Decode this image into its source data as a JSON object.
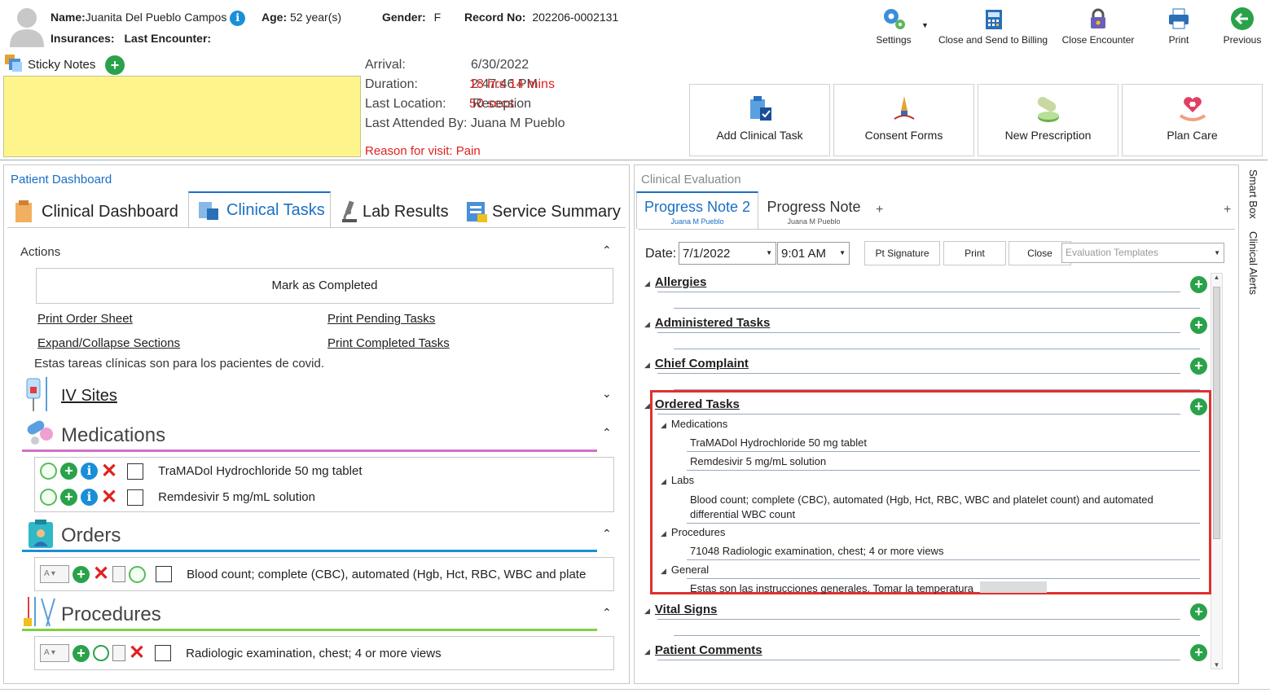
{
  "patient": {
    "name_label": "Name:",
    "name": "Juanita Del Pueblo Campos",
    "age_label": "Age:",
    "age": "52 year(s)",
    "gender_label": "Gender:",
    "gender": "F",
    "record_label": "Record No:",
    "record": "202206-0002131",
    "insurances_label": "Insurances:",
    "last_encounter_label": "Last Encounter:"
  },
  "sticky": {
    "label": "Sticky Notes"
  },
  "visit": {
    "arrival_label": "Arrival:",
    "arrival": "6/30/2022 2:47:46 PM",
    "duration_label": "Duration:",
    "duration": "18 hrs 14 mins 50 secs",
    "location_label": "Last Location:",
    "location": "Reception",
    "attended_label": "Last Attended By:",
    "attended": "Juana M Pueblo",
    "reason": "Reason for visit: Pain"
  },
  "toolbar": {
    "settings": "Settings",
    "billing": "Close and Send to Billing",
    "close_encounter": "Close Encounter",
    "print": "Print",
    "previous": "Previous"
  },
  "big_buttons": {
    "add_task": "Add Clinical Task",
    "consent": "Consent Forms",
    "prescription": "New Prescription",
    "plan_care": "Plan Care"
  },
  "dashboard": {
    "title": "Patient Dashboard",
    "tabs": [
      "Clinical Dashboard",
      "Clinical Tasks",
      "Lab Results",
      "Service Summary"
    ],
    "actions_label": "Actions",
    "mark_completed": "Mark as Completed",
    "print_order": "Print Order Sheet",
    "print_pending": "Print Pending Tasks",
    "expand_collapse": "Expand/Collapse Sections",
    "print_completed": "Print Completed Tasks",
    "note": "Estas tareas clínicas son para los pacientes de covid.",
    "iv_sites": "IV Sites",
    "medications_label": "Medications",
    "medications": [
      "TraMADol Hydrochloride 50 mg tablet",
      "Remdesivir 5 mg/mL solution"
    ],
    "orders_label": "Orders",
    "order_item": "Blood count; complete (CBC), automated (Hgb, Hct, RBC, WBC and plate",
    "procedures_label": "Procedures",
    "procedure_item": "Radiologic examination, chest; 4 or more views",
    "dd_text": "A"
  },
  "evaluation": {
    "title": "Clinical Evaluation",
    "tab1": "Progress Note 2",
    "tab1_sub": "Juana M Pueblo",
    "tab2": "Progress Note",
    "tab2_sub": "Juana M Pueblo",
    "plus": "+",
    "date_label": "Date:",
    "date": "7/1/2022",
    "time": "9:01 AM",
    "pt_signature": "Pt Signature",
    "print": "Print",
    "close": "Close",
    "templates_placeholder": "Evaluation Templates",
    "sections": {
      "allergies": "Allergies",
      "administered": "Administered Tasks",
      "chief": "Chief Complaint",
      "ordered": "Ordered Tasks",
      "vital": "Vital Signs",
      "comments": "Patient Comments"
    },
    "ordered": {
      "medications_label": "Medications",
      "medications": [
        "TraMADol Hydrochloride 50 mg tablet",
        "Remdesivir 5 mg/mL solution"
      ],
      "labs_label": "Labs",
      "lab_line1": "Blood count; complete (CBC), automated (Hgb, Hct, RBC, WBC and platelet count) and automated",
      "lab_line2": "differential WBC count",
      "procedures_label": "Procedures",
      "procedure": "71048 Radiologic examination, chest; 4 or more views",
      "general_label": "General",
      "general": "Estas son las instrucciones generales. Tomar la temperatura"
    }
  },
  "side": {
    "smart_box": "Smart Box",
    "clinical_alerts": "Clinical Alerts"
  },
  "colors": {
    "accent": "#1a6fc4",
    "highlight": "#e03030",
    "sticky": "#fdf58c",
    "duration": "#e02020"
  }
}
